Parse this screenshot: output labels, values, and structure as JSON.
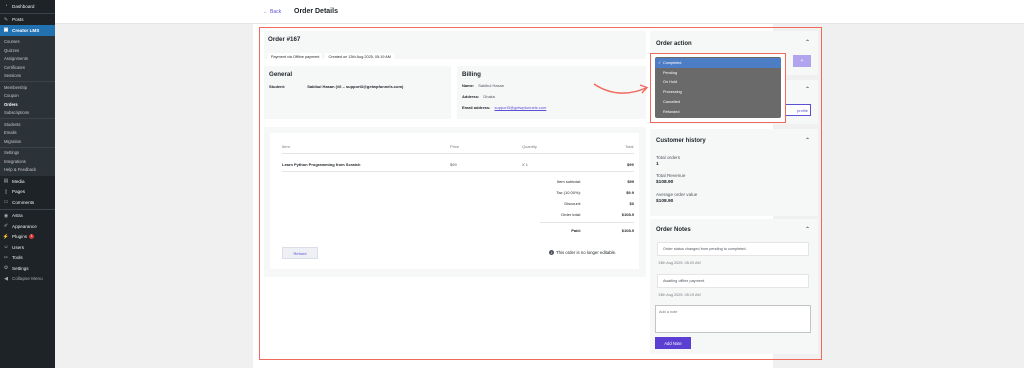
{
  "sidebar": {
    "top": [
      {
        "label": "Dashboard",
        "icon": "dashboard-icon",
        "glyph": "◔"
      },
      {
        "label": "Posts",
        "icon": "pin-icon",
        "glyph": "✎"
      },
      {
        "label": "Creator LMS",
        "icon": "lms-icon",
        "glyph": "▣"
      }
    ],
    "lms_sub": [
      "Courses",
      "Quizzes",
      "Assignments",
      "Certificates",
      "Sessions"
    ],
    "lms_sub2": [
      "Membership",
      "Coupon",
      "Orders",
      "Subscriptions"
    ],
    "lms_sub3": [
      "Students",
      "Emails",
      "Migration"
    ],
    "lms_sub4": [
      "Settings",
      "Integrations",
      "Help & Feedback"
    ],
    "bottom": [
      {
        "label": "Media",
        "icon": "media-icon",
        "glyph": "▤"
      },
      {
        "label": "Pages",
        "icon": "pages-icon",
        "glyph": "▯"
      },
      {
        "label": "Comments",
        "icon": "comments-icon",
        "glyph": "▭"
      },
      {
        "label": "Astra",
        "icon": "astra-icon",
        "glyph": "◉"
      },
      {
        "label": "Appearance",
        "icon": "appearance-icon",
        "glyph": "✐"
      },
      {
        "label": "Plugins",
        "icon": "plugins-icon",
        "glyph": "⚡",
        "badge": "1"
      },
      {
        "label": "Users",
        "icon": "users-icon",
        "glyph": "☺"
      },
      {
        "label": "Tools",
        "icon": "tools-icon",
        "glyph": "✂"
      },
      {
        "label": "Settings",
        "icon": "settings-icon",
        "glyph": "⚙"
      },
      {
        "label": "Collapse Menu",
        "icon": "collapse-icon",
        "glyph": "◀"
      }
    ]
  },
  "header": {
    "back": "Back",
    "title": "Order Details"
  },
  "order": {
    "title": "Order #167",
    "payment": "Payment via Offline payment",
    "created": "Created on 13th Aug 2025, 05:19 AM"
  },
  "general": {
    "title": "General",
    "student_label": "Student:",
    "student_value": "Sakibul Hasan (#6 – support3@getwpfunnels.com)"
  },
  "billing": {
    "title": "Billing",
    "name_label": "Name:",
    "name_value": "Sakibul Hasan",
    "address_label": "Address:",
    "address_value": "Dhaka",
    "email_label": "Email address:",
    "email_value": "support3@getwpfunnels.com"
  },
  "items": {
    "headers": {
      "item": "Item",
      "price": "Price",
      "quantity": "Quantity",
      "total": "Total"
    },
    "row": {
      "item": "Learn Python Programming from Scratch",
      "price": "$99",
      "quantity": "X 1",
      "total": "$99"
    },
    "summary": [
      {
        "label": "Item subtotal:",
        "value": "$99"
      },
      {
        "label": "Tax (10.00%):",
        "value": "$9.9"
      },
      {
        "label": "Discount:",
        "value": "$0"
      },
      {
        "label": "Order total:",
        "value": "$108.9"
      },
      {
        "label": "Paid:",
        "value": "$108.9"
      }
    ],
    "refund": "Refund",
    "not_editable": "This order is no longer editable."
  },
  "order_action": {
    "title": "Order action",
    "options": [
      "Completed",
      "Pending",
      "On Hold",
      "Processing",
      "Cancelled",
      "Refunded"
    ],
    "selected": "Completed",
    "profile_btn": "profile"
  },
  "customer_history": {
    "title": "Customer history",
    "total_orders_label": "Total orders",
    "total_orders": "1",
    "total_revenue_label": "Total Revenue",
    "total_revenue": "$108.90",
    "avg_label": "Average order value",
    "avg": "$108.90"
  },
  "order_notes": {
    "title": "Order Notes",
    "notes": [
      {
        "text": "Order status changed from pending to completed.",
        "time": "13th Aug 2025, 05:20 AM"
      },
      {
        "text": "Awaiting offline payment.",
        "time": "13th Aug 2025, 05:19 AM"
      }
    ],
    "placeholder": "Add a note",
    "add_btn": "Add Note"
  },
  "colors": {
    "accent": "#5b3fd3",
    "highlight": "#f2695a",
    "wp_blue": "#2271b1"
  }
}
